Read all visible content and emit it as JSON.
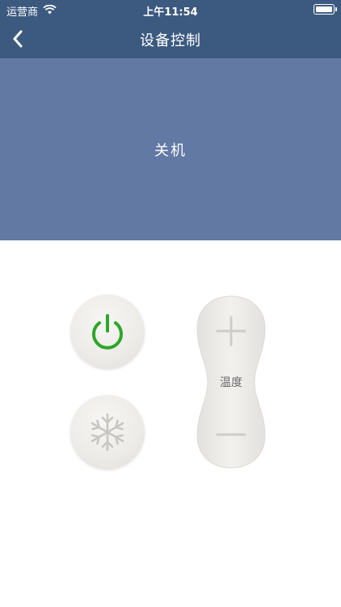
{
  "status_bar": {
    "carrier": "运营商",
    "time": "上午11:54",
    "icons": [
      "wifi-icon",
      "battery-icon"
    ]
  },
  "nav": {
    "title": "设备控制",
    "back_icon": "chevron-left-icon"
  },
  "device": {
    "state_text": "关机"
  },
  "controls": {
    "power_icon": "power-icon",
    "mode_icon": "snowflake-icon",
    "temperature_label": "温度",
    "plus_icon": "plus-icon",
    "minus_icon": "minus-icon"
  },
  "colors": {
    "header_bg": "#3c5a7f",
    "panel_bg": "#6179a3",
    "power_green": "#2ea62a",
    "button_bg": "#ecebe7",
    "icon_gray": "#c8c6c2"
  }
}
